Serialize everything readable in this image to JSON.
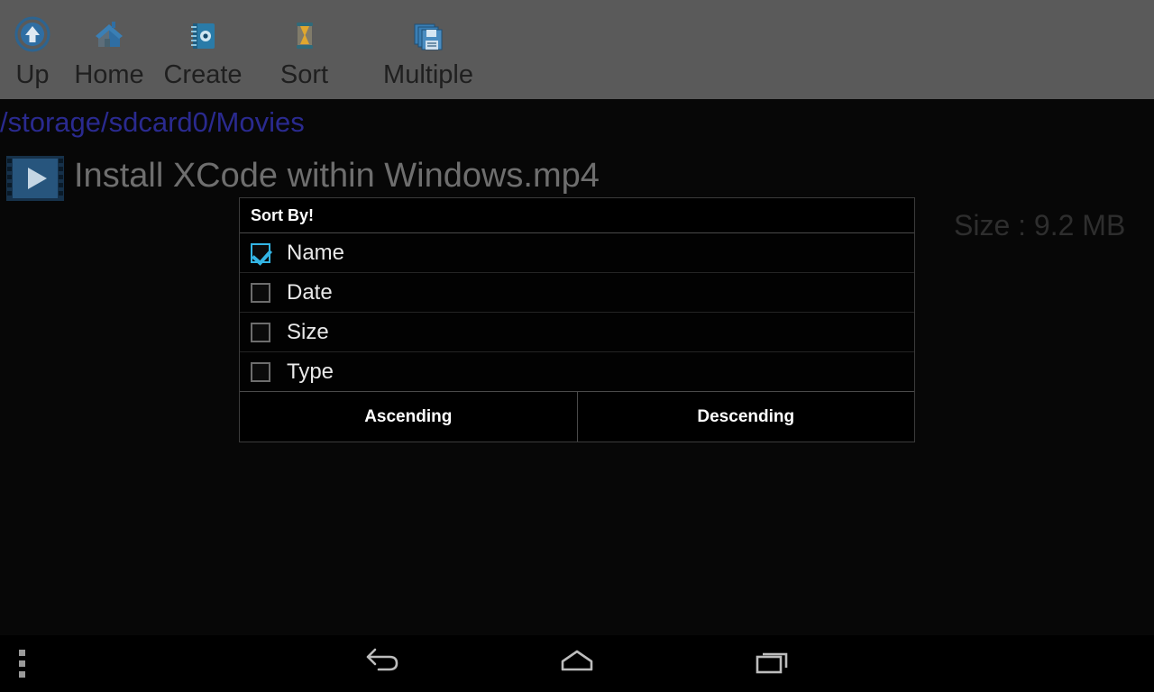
{
  "toolbar": {
    "items": [
      {
        "label": "Up",
        "icon": "up-arrow-circle-icon"
      },
      {
        "label": "Home",
        "icon": "house-icon"
      },
      {
        "label": "Create",
        "icon": "notebook-icon"
      },
      {
        "label": "Sort",
        "icon": "hourglass-icon"
      },
      {
        "label": "Multiple",
        "icon": "floppy-stack-icon"
      }
    ]
  },
  "path": "/storage/sdcard0/Movies",
  "file": {
    "name": "Install XCode within Windows.mp4",
    "size": "Size : 9.2 MB",
    "icon": "video-film-icon"
  },
  "dialog": {
    "title": "Sort By!",
    "options": [
      {
        "label": "Name",
        "checked": true
      },
      {
        "label": "Date",
        "checked": false
      },
      {
        "label": "Size",
        "checked": false
      },
      {
        "label": "Type",
        "checked": false
      }
    ],
    "buttons": [
      {
        "label": "Ascending"
      },
      {
        "label": "Descending"
      }
    ]
  },
  "navbar": {
    "back": "back-icon",
    "home": "home-icon",
    "recents": "recents-icon",
    "menu": "overflow-menu-icon"
  },
  "colors": {
    "accent": "#33b5e5",
    "toolbar_bg": "#5a5a5a",
    "path_text": "#2a2a8f",
    "dialog_bg": "#000000"
  }
}
